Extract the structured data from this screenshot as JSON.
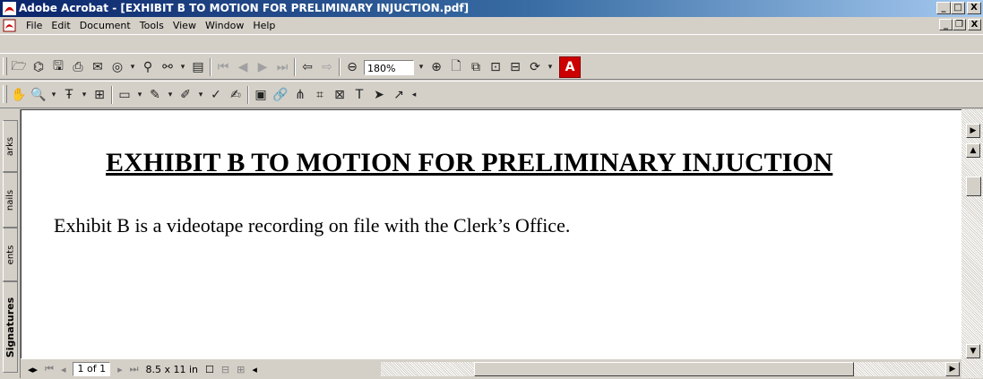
{
  "window": {
    "title": "Adobe Acrobat - [EXHIBIT B TO MOTION FOR PRELIMINARY INJUCTION.pdf]",
    "buttons": {
      "minimize": "_",
      "maximize": "□",
      "close": "X"
    }
  },
  "menubar": {
    "items": [
      "File",
      "Edit",
      "Document",
      "Tools",
      "View",
      "Window",
      "Help"
    ],
    "doc_buttons": {
      "minimize": "_",
      "restore": "❐",
      "close": "X"
    }
  },
  "toolbar1": {
    "zoom": "180%"
  },
  "nav_tabs": [
    "Bookmarks",
    "Thumbnails",
    "Comments",
    "Signatures"
  ],
  "nav_tabs_visible": {
    "bookmarks": "arks",
    "thumbnails": "nails",
    "comments": "ents",
    "signatures": "Signatures"
  },
  "document": {
    "heading": "EXHIBIT B TO MOTION FOR PRELIMINARY INJUCTION",
    "body": "Exhibit B is a videotape recording on file with the Clerk’s Office."
  },
  "statusbar": {
    "page": "1 of 1",
    "page_size": "8.5 x 11 in"
  },
  "colors": {
    "titlebar_start": "#0a246a",
    "titlebar_end": "#a6caf0",
    "chrome": "#d4d0c8",
    "adobe_red": "#cc0000"
  }
}
